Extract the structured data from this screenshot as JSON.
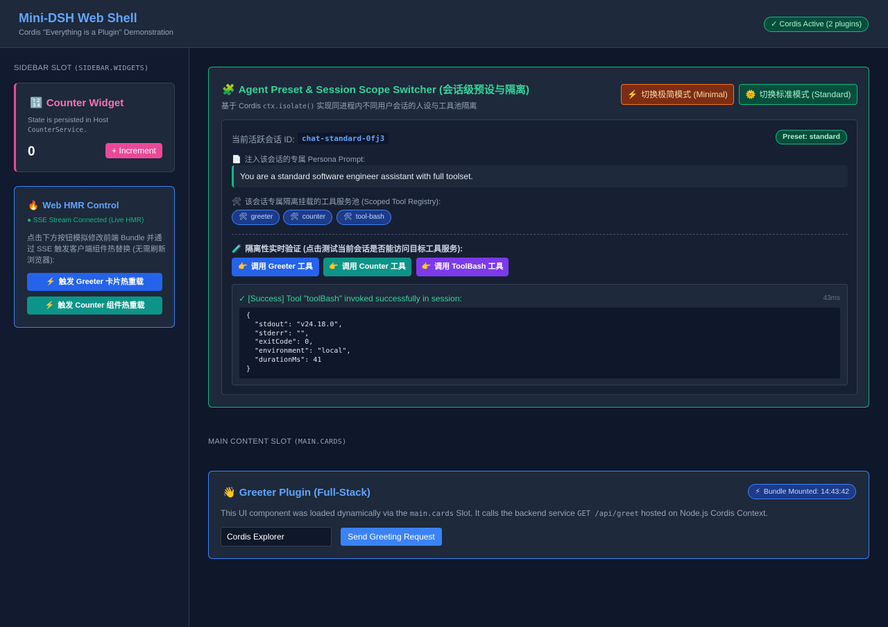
{
  "header": {
    "title": "Mini-DSH Web Shell",
    "subtitle": "Cordis \"Everything is a Plugin\" Demonstration",
    "status_badge": "✓ Cordis Active (2 plugins)"
  },
  "sidebar": {
    "slot_label_prefix": "SIDEBAR SLOT",
    "slot_label_code": "(SIDEBAR.WIDGETS)",
    "counter_widget": {
      "icon": "🔢",
      "title": "Counter Widget",
      "desc_line1": "State is persisted in Host",
      "desc_code": "CounterService.",
      "value": "0",
      "increment_label": "+ Increment"
    },
    "hmr_control": {
      "icon": "🔥",
      "title": "Web HMR Control",
      "status": "● SSE Stream Connected (Live HMR)",
      "description": "点击下方按钮模拟修改前端 Bundle 并通过 SSE 触发客户端组件热替换 (无需刷新浏览器):",
      "greeter_reload_label": "触发 Greeter 卡片热重载",
      "counter_reload_label": "触发 Counter 组件热重载",
      "bolt_icon": "⚡"
    }
  },
  "preset_switcher": {
    "icon": "🧩",
    "title": "Agent Preset & Session Scope Switcher (会话级预设与隔离)",
    "subtitle_prefix": "基于 Cordis",
    "subtitle_code": "ctx.isolate()",
    "subtitle_suffix": "实现同进程内不同用户会话的人设与工具池隔离",
    "minimal_mode_label": "切换极简模式 (Minimal)",
    "standard_mode_label": "切换标准模式 (Standard)",
    "sun_icon": "🌞",
    "session": {
      "id_label": "当前活跃会话 ID:",
      "id_value": "chat-standard-0fj3",
      "preset_badge": "Preset: standard",
      "persona_label": "注入该会话的专属 Persona Prompt:",
      "persona_icon": "📄",
      "persona_prompt": "You are a standard software engineer assistant with full toolset.",
      "registry_icon": "🛠",
      "registry_label": "该会话专属隔离挂载的工具服务池 (Scoped Tool Registry):",
      "tools": [
        "greeter",
        "counter",
        "tool-bash"
      ],
      "verify_icon": "🧪",
      "verify_label": "隔离性实时验证 (点击测试当前会话是否能访问目标工具服务):",
      "point_icon": "👉",
      "invoke_greeter_label": "调用 Greeter 工具",
      "invoke_counter_label": "调用 Counter 工具",
      "invoke_toolbash_label": "调用 ToolBash 工具",
      "result": {
        "message": "✓ [Success] Tool \"toolBash\" invoked successfully in session:",
        "duration": "43ms",
        "output": "{\n  \"stdout\": \"v24.18.0\",\n  \"stderr\": \"\",\n  \"exitCode\": 0,\n  \"environment\": \"local\",\n  \"durationMs\": 41\n}"
      }
    }
  },
  "main": {
    "slot_label_prefix": "MAIN CONTENT SLOT",
    "slot_label_code": "(MAIN.CARDS)",
    "greeter_card": {
      "icon": "👋",
      "title": "Greeter Plugin (Full-Stack)",
      "bundle_badge": "Bundle Mounted: 14:43:42",
      "desc_part1": "This UI component was loaded dynamically via the",
      "desc_code1": "main.cards",
      "desc_part2": "Slot. It calls the backend service",
      "desc_code2": "GET /api/greet",
      "desc_part3": "hosted on Node.js Cordis Context.",
      "input_value": "Cordis Explorer",
      "send_label": "Send Greeting Request"
    }
  },
  "colors": {
    "background": "#0f172a",
    "accent_blue": "#3b82f6",
    "accent_green": "#10b981",
    "accent_pink": "#ec4899",
    "accent_orange": "#f97316",
    "accent_purple": "#7c3aed"
  }
}
